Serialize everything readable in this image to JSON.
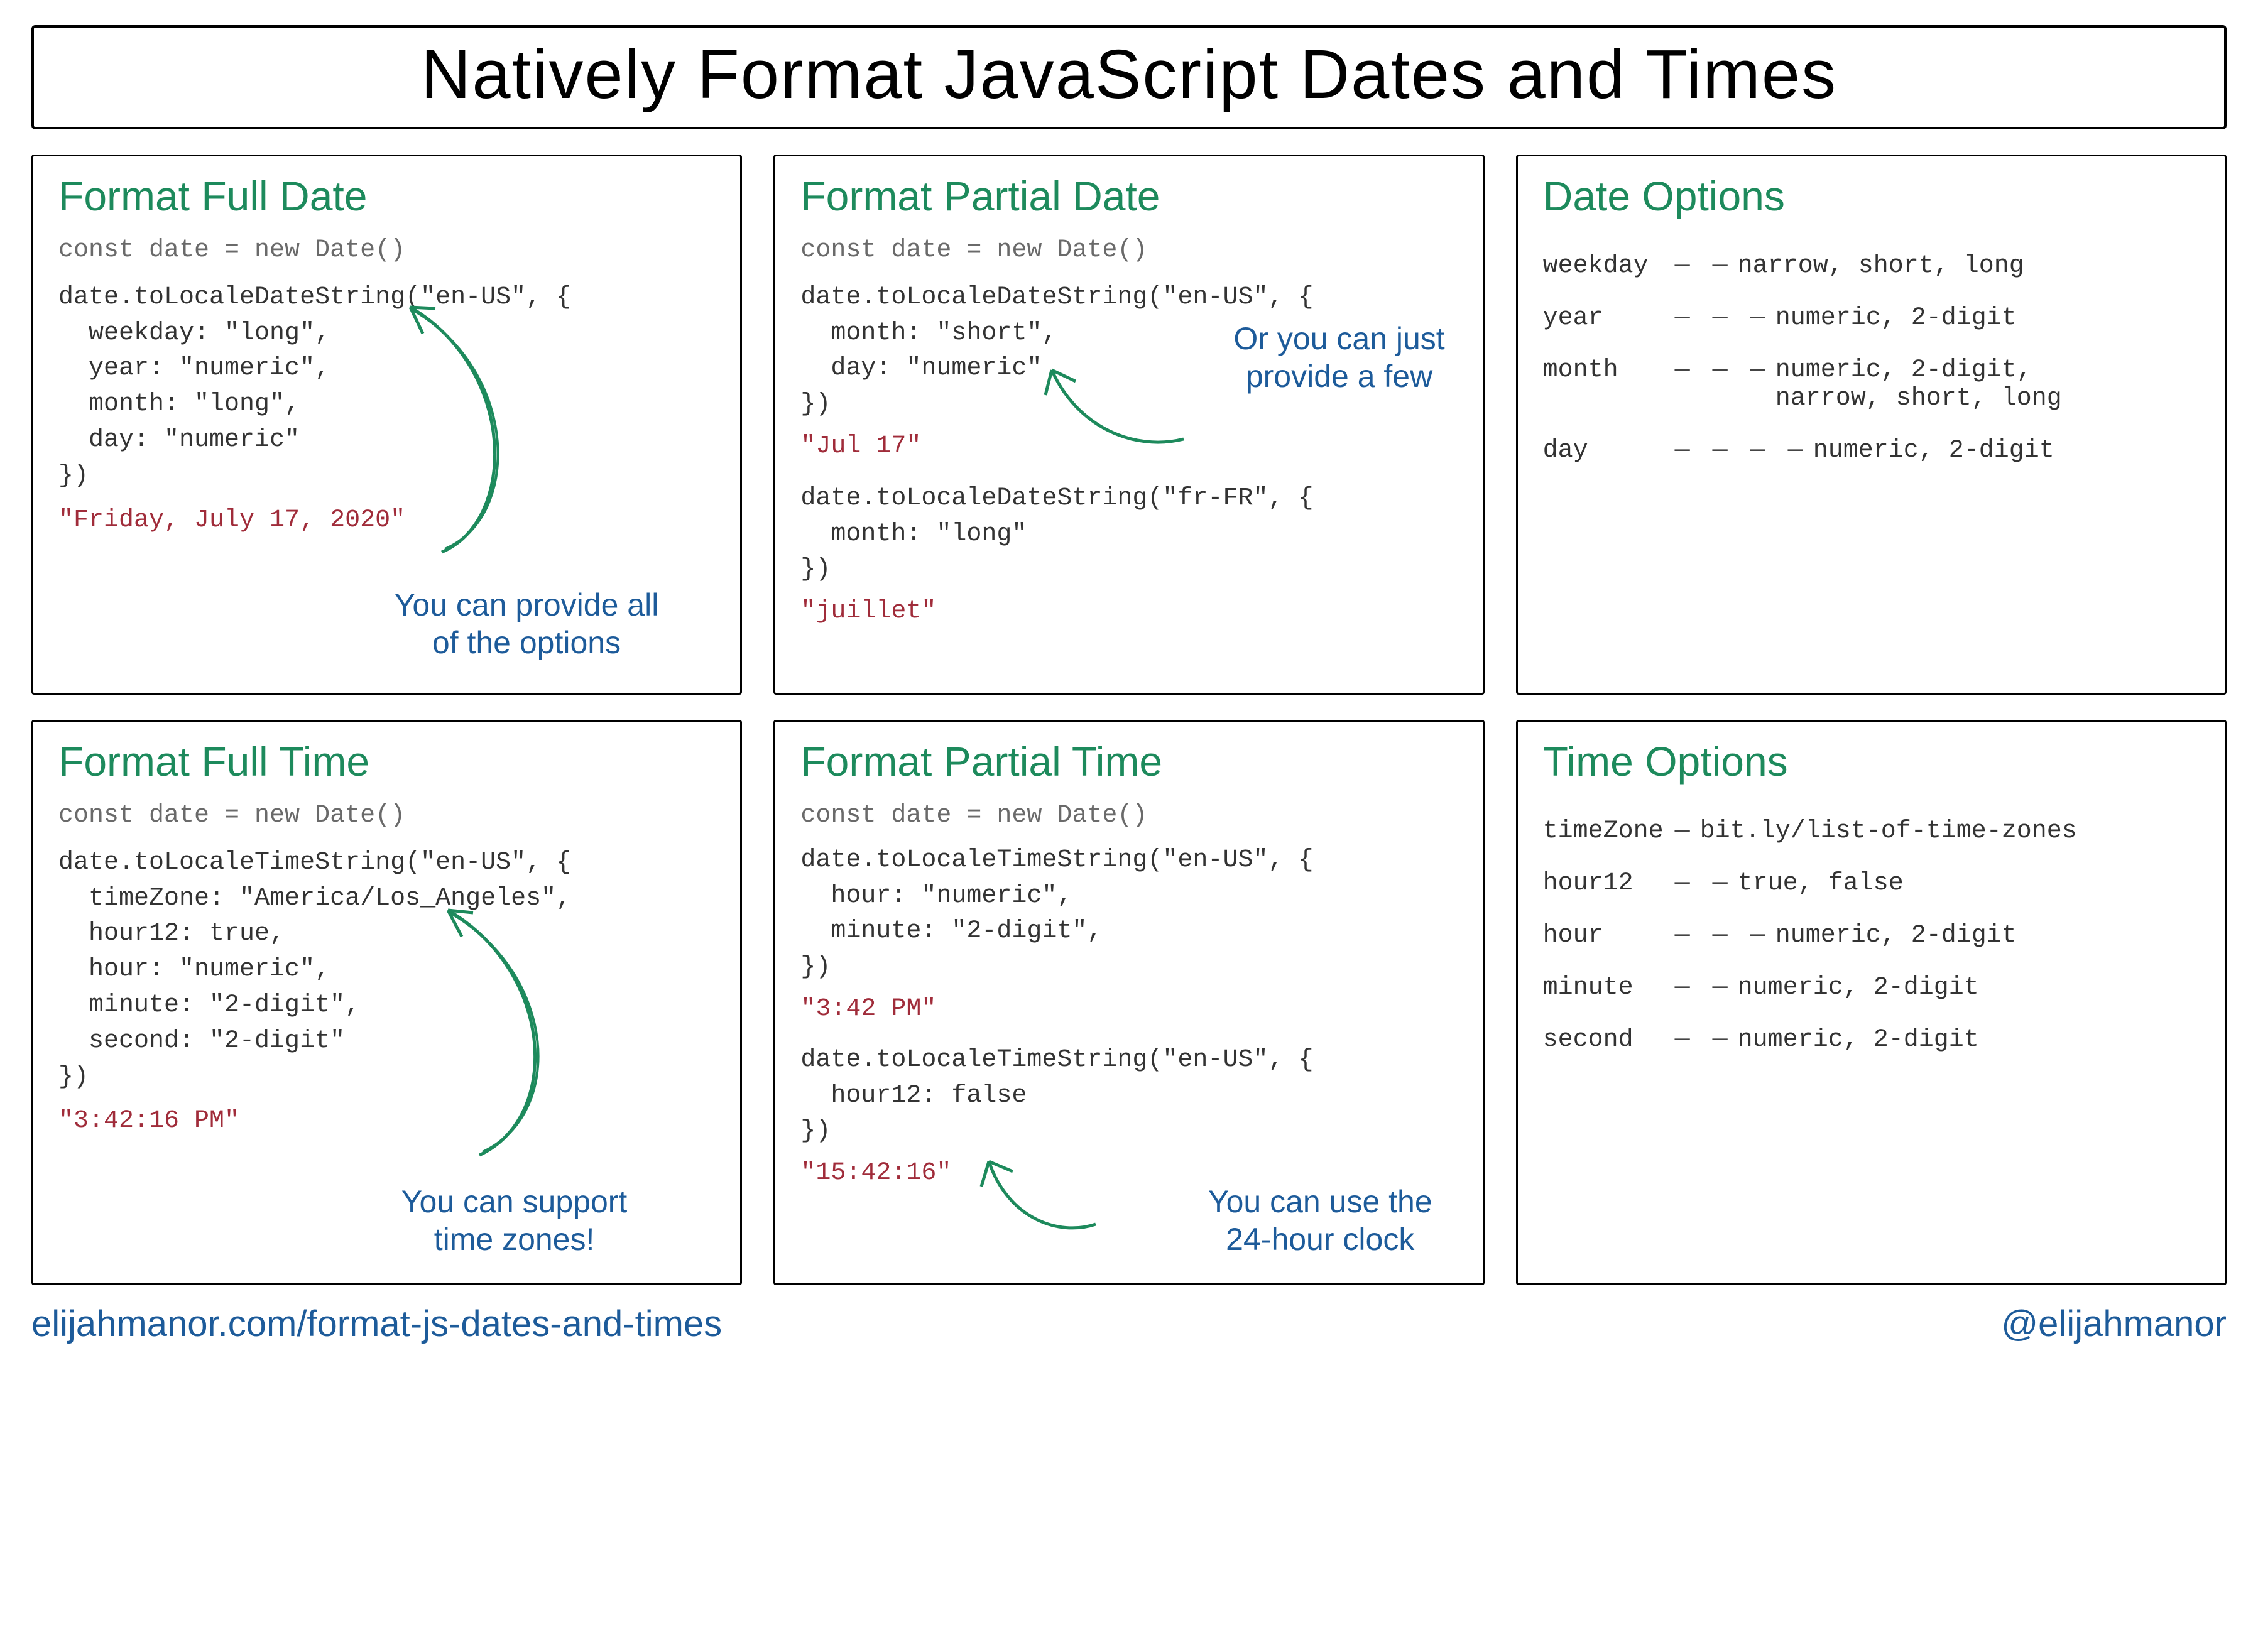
{
  "title": "Natively Format JavaScript Dates and Times",
  "panels": {
    "full_date": {
      "heading": "Format Full Date",
      "decl": "const date = new Date()",
      "code": "date.toLocaleDateString(\"en-US\", {\n  weekday: \"long\",\n  year: \"numeric\",\n  month: \"long\",\n  day: \"numeric\"\n})",
      "output": "\"Friday, July 17, 2020\"",
      "note": "You can provide all\nof the options"
    },
    "partial_date": {
      "heading": "Format Partial Date",
      "decl": "const date = new Date()",
      "code1": "date.toLocaleDateString(\"en-US\", {\n  month: \"short\",\n  day: \"numeric\"\n})",
      "output1": "\"Jul 17\"",
      "code2": "date.toLocaleDateString(\"fr-FR\", {\n  month: \"long\"\n})",
      "output2": "\"juillet\"",
      "note": "Or you can just\nprovide a few"
    },
    "date_options": {
      "heading": "Date Options",
      "rows": [
        {
          "k": "weekday",
          "dash": "— —",
          "v": "narrow, short, long"
        },
        {
          "k": "year",
          "dash": "— — —",
          "v": "numeric, 2-digit"
        },
        {
          "k": "month",
          "dash": "— — —",
          "v": "numeric, 2-digit,\nnarrow, short, long"
        },
        {
          "k": "day",
          "dash": "— — — —",
          "v": "numeric, 2-digit"
        }
      ]
    },
    "full_time": {
      "heading": "Format Full Time",
      "decl": "const date = new Date()",
      "code": "date.toLocaleTimeString(\"en-US\", {\n  timeZone: \"America/Los_Angeles\",\n  hour12: true,\n  hour: \"numeric\",\n  minute: \"2-digit\",\n  second: \"2-digit\"\n})",
      "output": "\"3:42:16 PM\"",
      "note": "You can support\ntime zones!"
    },
    "partial_time": {
      "heading": "Format Partial Time",
      "decl": "const date = new Date()",
      "code1": "date.toLocaleTimeString(\"en-US\", {\n  hour: \"numeric\",\n  minute: \"2-digit\",\n})",
      "output1": "\"3:42 PM\"",
      "code2": "date.toLocaleTimeString(\"en-US\", {\n  hour12: false\n})",
      "output2": "\"15:42:16\"",
      "note": "You can use the\n24-hour clock"
    },
    "time_options": {
      "heading": "Time Options",
      "rows": [
        {
          "k": "timeZone",
          "dash": "—",
          "v": "bit.ly/list-of-time-zones"
        },
        {
          "k": "hour12",
          "dash": "— —",
          "v": "true, false"
        },
        {
          "k": "hour",
          "dash": "— — —",
          "v": "numeric, 2-digit"
        },
        {
          "k": "minute",
          "dash": "— —",
          "v": "numeric, 2-digit"
        },
        {
          "k": "second",
          "dash": "— —",
          "v": "numeric, 2-digit"
        }
      ]
    }
  },
  "footer": {
    "left": "elijahmanor.com/format-js-dates-and-times",
    "right": "@elijahmanor"
  }
}
